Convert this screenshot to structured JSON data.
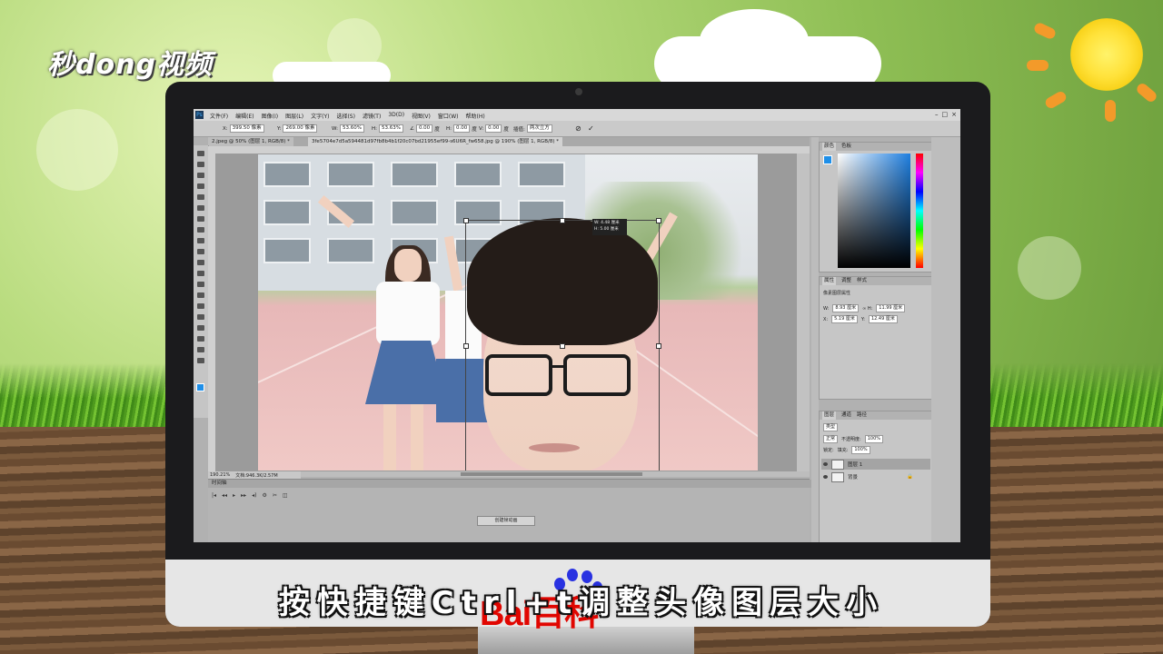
{
  "brand": {
    "logo_text": "秒dong视频",
    "watermark": "Bai百科"
  },
  "subtitle": "按快捷键Ctrl+t调整头像图层大小",
  "photoshop": {
    "menu": [
      "文件(F)",
      "编辑(E)",
      "图像(I)",
      "图层(L)",
      "文字(Y)",
      "选择(S)",
      "滤镜(T)",
      "3D(D)",
      "视图(V)",
      "窗口(W)",
      "帮助(H)"
    ],
    "options": {
      "x": "399.50 像素",
      "y": "269.00 像素",
      "w": "53.60%",
      "h": "53.63%",
      "angle": "0.00",
      "h_skew": "0.00",
      "v_skew": "0.00",
      "interp": "两次立方"
    },
    "tabs": [
      {
        "label": "2.jpeg @ 50% (图层 1, RGB/8) *"
      },
      {
        "label": "3fe5704e7d5a594481d97fb8b4b1f20c07bd21955ef99-s6U6R_fw658.jpg @ 190% (图层 1, RGB/8) *"
      }
    ],
    "transform_tooltip": [
      "W: 4.48 厘米",
      "H: 5.00 厘米"
    ],
    "status": {
      "zoom": "190.21%",
      "doc": "文档:946.3K/2.57M"
    },
    "timeline": {
      "title": "时间轴",
      "create_button": "创建帧动画"
    },
    "color_panel": {
      "tabs": [
        "颜色",
        "色板"
      ],
      "fg_color": "#1f8fe8"
    },
    "properties_panel": {
      "tabs": [
        "属性",
        "调整",
        "样式"
      ],
      "subtitle": "像素图层属性",
      "w": "8.93 厘米",
      "h": "11.99 厘米",
      "x": "5.19 厘米",
      "y": "12.49 厘米"
    },
    "layers_panel": {
      "tabs": [
        "图层",
        "通道",
        "路径"
      ],
      "filter": "类型",
      "mode": "正常",
      "opacity_label": "不透明度:",
      "opacity": "100%",
      "lock_label": "锁定:",
      "fill_label": "填充:",
      "fill": "100%",
      "layers": [
        {
          "name": "图层 1"
        },
        {
          "name": "背景"
        }
      ]
    }
  }
}
